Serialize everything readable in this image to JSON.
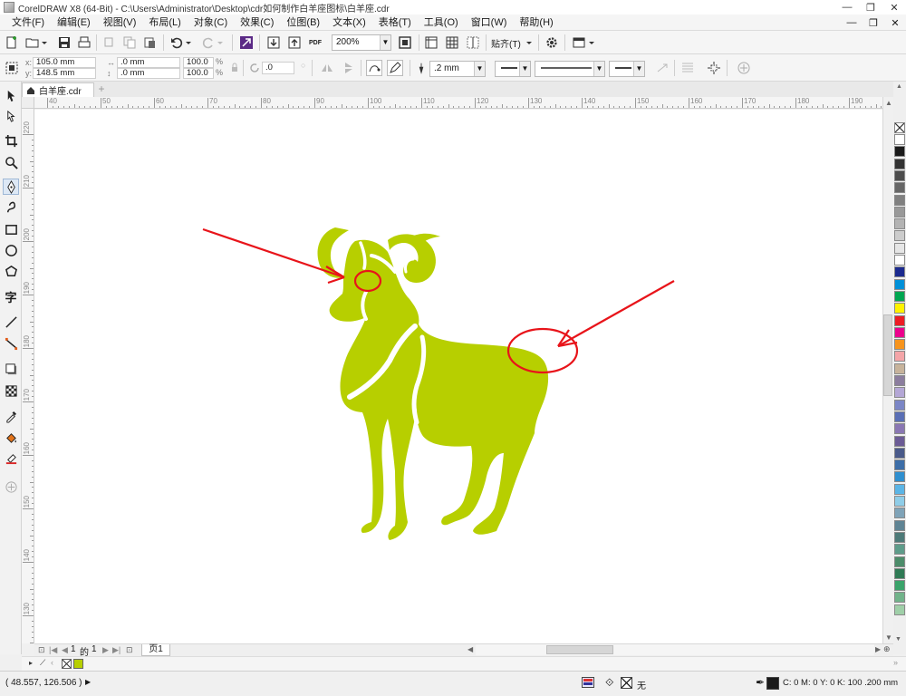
{
  "window": {
    "title": "CorelDRAW X8 (64-Bit) - C:\\Users\\Administrator\\Desktop\\cdr如何制作白羊座图标\\白羊座.cdr"
  },
  "menubar": {
    "items": [
      "文件(F)",
      "编辑(E)",
      "视图(V)",
      "布局(L)",
      "对象(C)",
      "效果(C)",
      "位图(B)",
      "文本(X)",
      "表格(T)",
      "工具(O)",
      "窗口(W)",
      "帮助(H)"
    ]
  },
  "standard_toolbar": {
    "zoom_level": "200%",
    "snap_label": "贴齐(T)",
    "pdf_label": "PDF"
  },
  "property_bar": {
    "x_pos": "105.0 mm",
    "y_pos": "148.5 mm",
    "width": ".0 mm",
    "height": ".0 mm",
    "scale_x": "100.0",
    "scale_y": "100.0",
    "percent": "%",
    "rotation": ".0",
    "outline_width": ".2 mm"
  },
  "document_tab": {
    "label": "白羊座.cdr"
  },
  "rulers": {
    "horizontal_labels": [
      "40",
      "50",
      "60",
      "70",
      "80",
      "90",
      "100",
      "110",
      "120",
      "130",
      "140",
      "150",
      "160",
      "170",
      "180",
      "190"
    ],
    "vertical_labels": [
      "220",
      "210",
      "200",
      "190",
      "180",
      "170",
      "160",
      "150",
      "140",
      "130"
    ]
  },
  "artwork": {
    "fill_color": "#b7cf00",
    "annotation_color": "#e8141a"
  },
  "page_nav": {
    "current": "1",
    "of_label": "的",
    "total": "1",
    "page_tab": "页1"
  },
  "status": {
    "cursor_coords": "( 48.557, 126.506 )",
    "fill_none_label": "无",
    "outline_info": "C: 0 M: 0 Y: 0 K: 100  .200 mm"
  },
  "palette_colors": [
    "#ffffff",
    "#1a1a1a",
    "#333333",
    "#4d4d4d",
    "#666666",
    "#808080",
    "#999999",
    "#b3b3b3",
    "#cccccc",
    "#e6e6e6",
    "#ffffff",
    "#1b2a8f",
    "#0090d8",
    "#00a651",
    "#fff200",
    "#ed1c24",
    "#ec008c",
    "#f7941d",
    "#f4a5a8",
    "#c7b39b",
    "#8b7d9e",
    "#b4a7d6",
    "#7b86c6",
    "#5a6fb5",
    "#8a77b3",
    "#6b5b95",
    "#4a5a8a",
    "#3d6ea8",
    "#2f8fcf",
    "#5bb5e6",
    "#8fcde8",
    "#7fa3b8",
    "#5f8494",
    "#4d7a78",
    "#5e9c8a",
    "#4c8c6a",
    "#2f7a55",
    "#3aa36a",
    "#71b38a",
    "#9fcfa8"
  ]
}
